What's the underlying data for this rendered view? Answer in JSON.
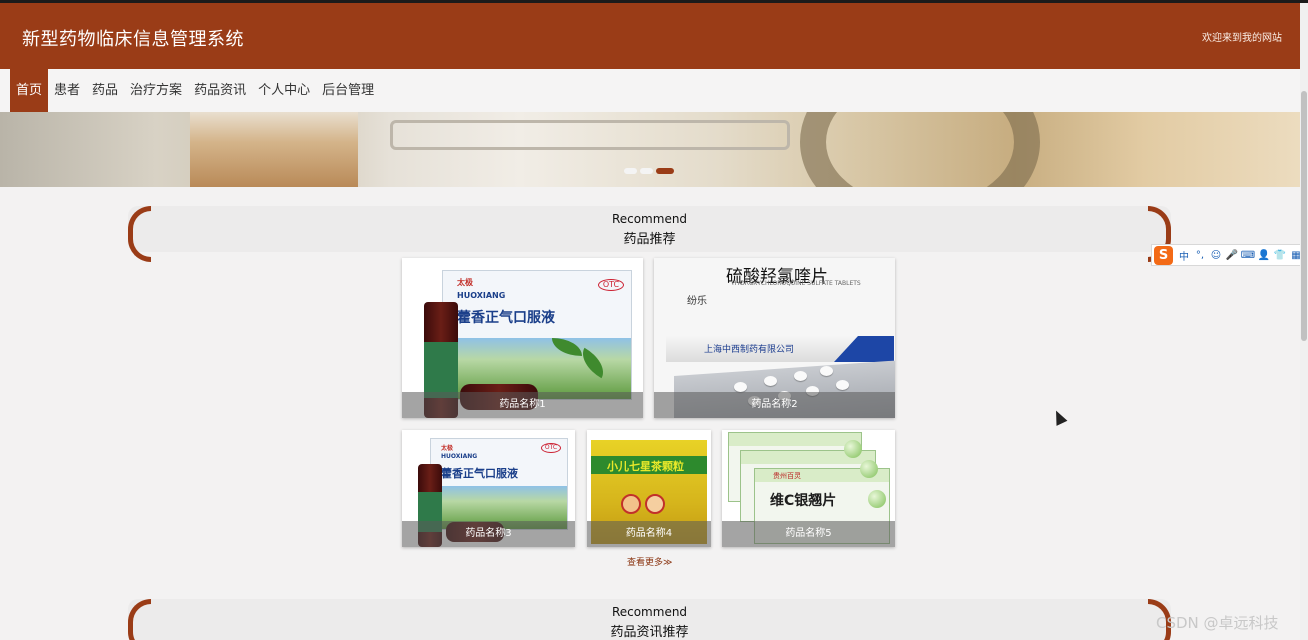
{
  "header": {
    "site_title": "新型药物临床信息管理系统",
    "welcome": "欢迎来到我的网站"
  },
  "nav": {
    "items": [
      "首页",
      "患者",
      "药品",
      "治疗方案",
      "药品资讯",
      "个人中心",
      "后台管理"
    ],
    "active_index": 0
  },
  "banner": {
    "slides": 3,
    "active_slide": 2
  },
  "sections": [
    {
      "en": "Recommend",
      "cn": "药品推荐"
    },
    {
      "en": "Recommend",
      "cn": "药品资讯推荐"
    }
  ],
  "products": [
    {
      "name": "药品名称1"
    },
    {
      "name": "药品名称2"
    },
    {
      "name": "药品名称3"
    },
    {
      "name": "药品名称4"
    },
    {
      "name": "药品名称5"
    }
  ],
  "artwork": {
    "huoxiang_brand": "太极",
    "huoxiang_pinyin": "HUOXIANG",
    "huoxiang_name": "藿香正气口服液",
    "otc": "OTC",
    "hcq_name": "硫酸羟氯喹片",
    "hcq_en": "HYDROXYCHLOROQUINE SULFATE TABLETS",
    "hcq_brand": "纷乐",
    "hcq_company": "上海中西制药有限公司",
    "kids_name": "小儿七星茶颗粒",
    "yinqiao_brand": "贵州百灵",
    "yinqiao_name": "维C银翘片"
  },
  "more_link": "查看更多≫",
  "ime": {
    "logo": "S",
    "items": [
      "中",
      "°,",
      "☺",
      "🎤",
      "⌨",
      "👤",
      "👕",
      "▦"
    ]
  },
  "watermark": "CSDN @卓远科技",
  "colors": {
    "brand": "#9a3c17",
    "background": "#f3f2f2",
    "nav_bg": "#f5f4f4"
  }
}
